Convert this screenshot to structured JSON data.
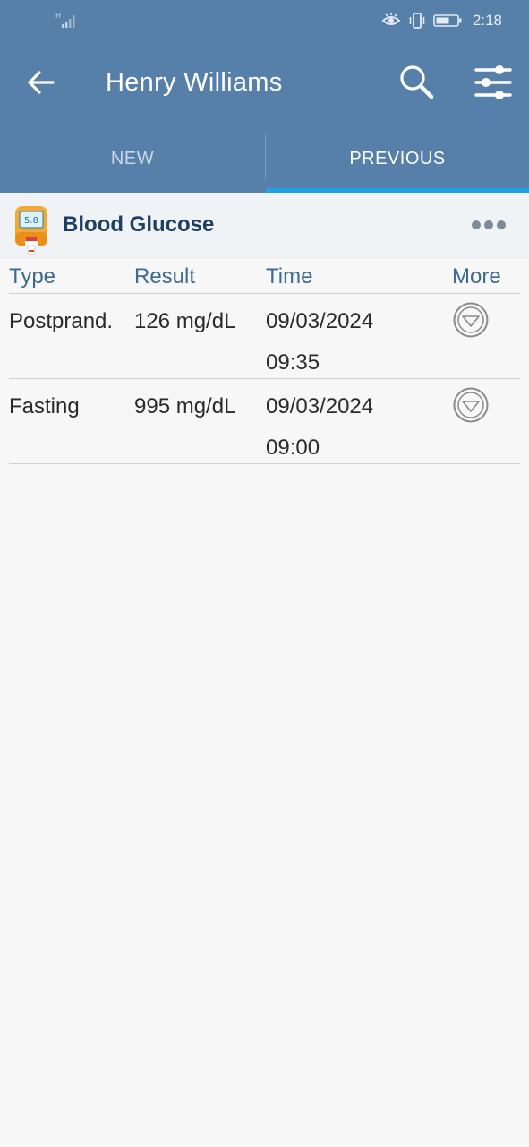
{
  "status_bar": {
    "time": "2:18",
    "icons": [
      "signal-icon",
      "eye-icon",
      "vibrate-icon",
      "battery-icon"
    ]
  },
  "app_bar": {
    "title": "Henry Williams",
    "icons": [
      "back-arrow-icon",
      "search-icon",
      "filter-sliders-icon"
    ]
  },
  "tabs": [
    {
      "label": "NEW",
      "active": false
    },
    {
      "label": "PREVIOUS",
      "active": true
    }
  ],
  "section": {
    "title": "Blood Glucose",
    "icon": "glucose-meter-icon",
    "meter_reading": "5.8"
  },
  "table": {
    "headers": [
      "Type",
      "Result",
      "Time",
      "More"
    ],
    "rows": [
      {
        "type": "Postprand.",
        "result": "126 mg/dL",
        "date": "09/03/2024",
        "time": "09:35"
      },
      {
        "type": "Fasting",
        "result": "995 mg/dL",
        "date": "09/03/2024",
        "time": "09:00"
      }
    ]
  },
  "colors": {
    "app_bar": "#5680a9",
    "tab_indicator": "#1ea2e6",
    "header_text": "#3c6a95",
    "section_title": "#1d3f62",
    "page_background": "#f7f7f7"
  }
}
